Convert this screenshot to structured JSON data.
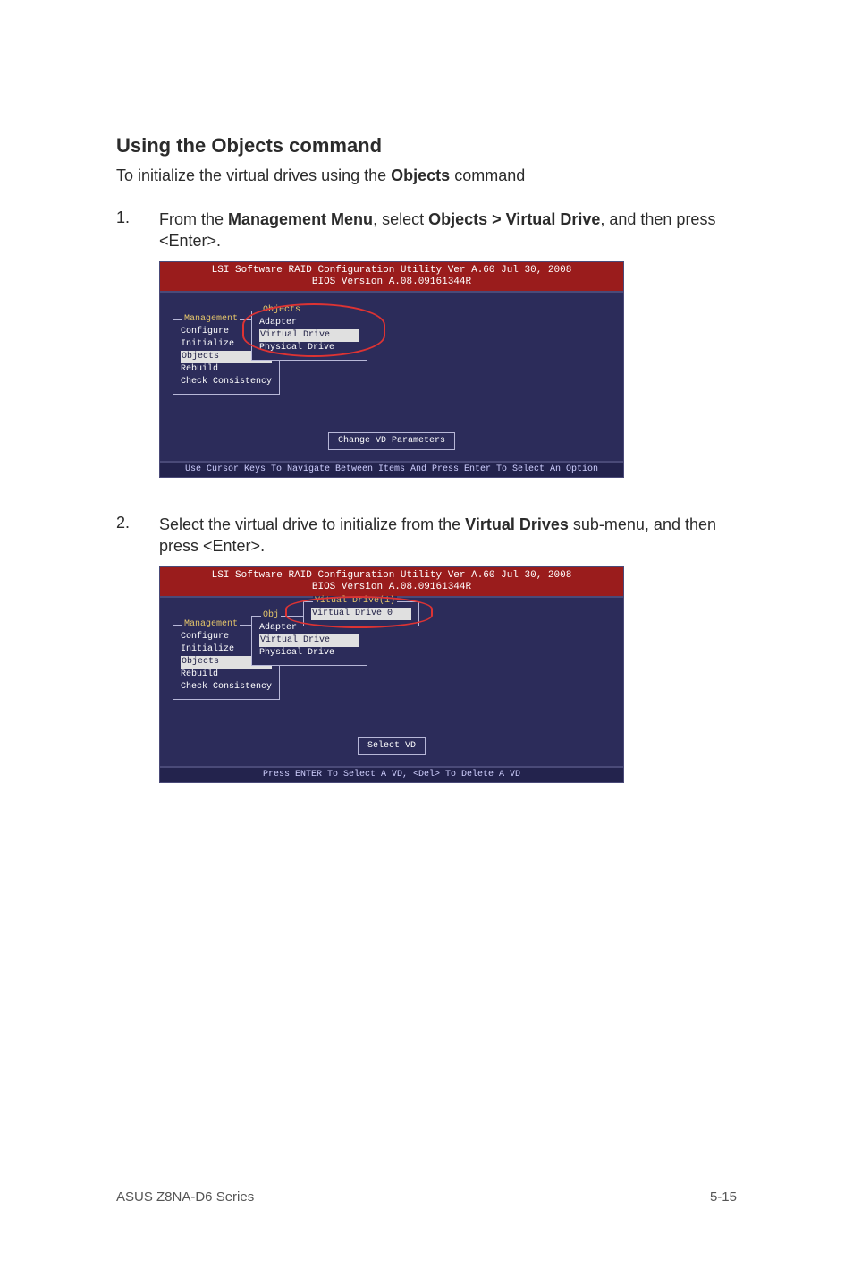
{
  "heading": "Using the Objects command",
  "intro_pre": "To initialize the virtual drives using the ",
  "intro_bold": "Objects",
  "intro_post": " command",
  "steps": [
    {
      "num": "1.",
      "parts": [
        {
          "t": "From the "
        },
        {
          "b": "Management Menu"
        },
        {
          "t": ", select "
        },
        {
          "b": "Objects > Virtual Drive"
        },
        {
          "t": ", and then press <Enter>."
        }
      ]
    },
    {
      "num": "2.",
      "parts": [
        {
          "t": "Select the virtual drive to initialize from the "
        },
        {
          "b": "Virtual Drives"
        },
        {
          "t": " sub-menu, and then press <Enter>."
        }
      ]
    }
  ],
  "bios": {
    "title_line1": "LSI Software RAID Configuration Utility Ver A.60 Jul 30, 2008",
    "title_line2": "BIOS Version   A.08.09161344R",
    "mgmt_legend": "Management",
    "mgmt_items": [
      "Configure",
      "Initialize",
      "Objects",
      "Rebuild",
      "Check Consistency"
    ],
    "objs_legend": "Objects",
    "objs_legend_short": "Obj",
    "objs_items": [
      "Adapter",
      "Virtual Drive",
      "Physical Drive"
    ],
    "vd_legend": "Vitual Drive(1)",
    "vd_items": [
      "Virtual Drive 0"
    ],
    "desc1": "Change VD Parameters",
    "desc2": "Select VD",
    "footer1": "Use Cursor Keys To Navigate Between Items And Press Enter To Select An Option",
    "footer2": "Press ENTER To Select A VD, <Del> To Delete A VD"
  },
  "footer": {
    "left": "ASUS Z8NA-D6 Series",
    "right": "5-15"
  }
}
